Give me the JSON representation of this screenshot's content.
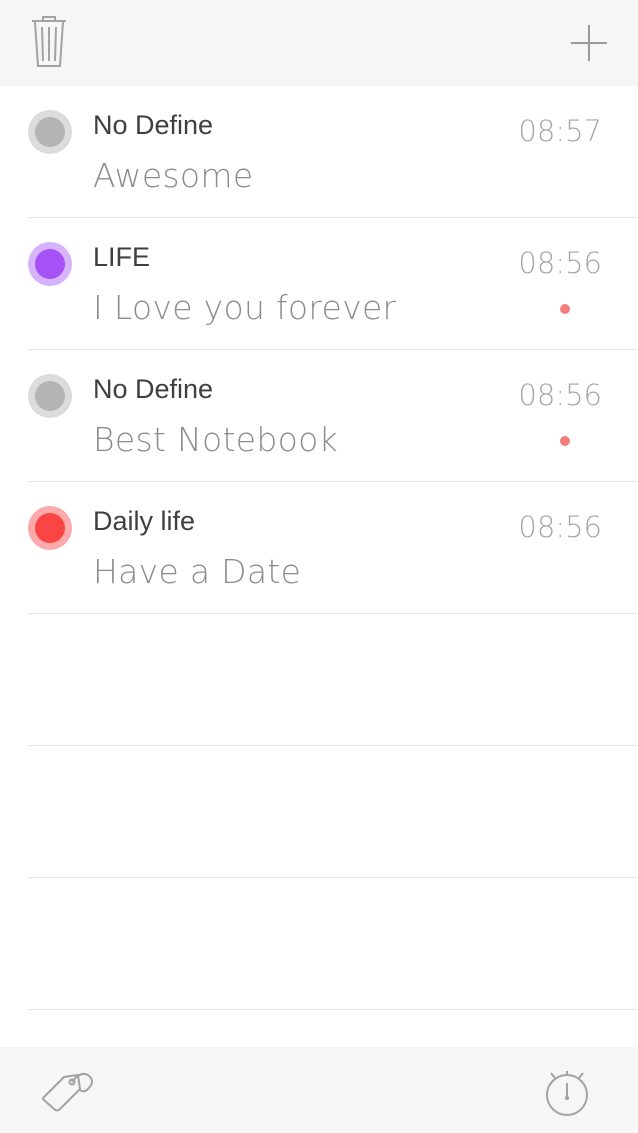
{
  "toolbar": {
    "trash_icon": "trash-icon",
    "add_icon": "plus-icon"
  },
  "notes": [
    {
      "category": "No Define",
      "title": "Awesome",
      "time": "08:57",
      "color": "#b4b4b4",
      "ring": "#dcdcdc",
      "reminder": false
    },
    {
      "category": "LIFE",
      "title": "I Love you forever",
      "time": "08:56",
      "color": "#a652f7",
      "ring": "#d7b3fb",
      "reminder": true
    },
    {
      "category": "No Define",
      "title": "Best Notebook",
      "time": "08:56",
      "color": "#b4b4b4",
      "ring": "#dcdcdc",
      "reminder": true
    },
    {
      "category": "Daily life",
      "title": "Have a Date",
      "time": "08:56",
      "color": "#fb4444",
      "ring": "#fcaaaa",
      "reminder": false
    }
  ],
  "bottom_bar": {
    "tag_icon": "tag-icon",
    "timer_icon": "stopwatch-icon"
  },
  "colors": {
    "reminder_dot": "#f37e7e",
    "bar_background": "#f6f6f6",
    "divider": "#e4e4e4"
  }
}
